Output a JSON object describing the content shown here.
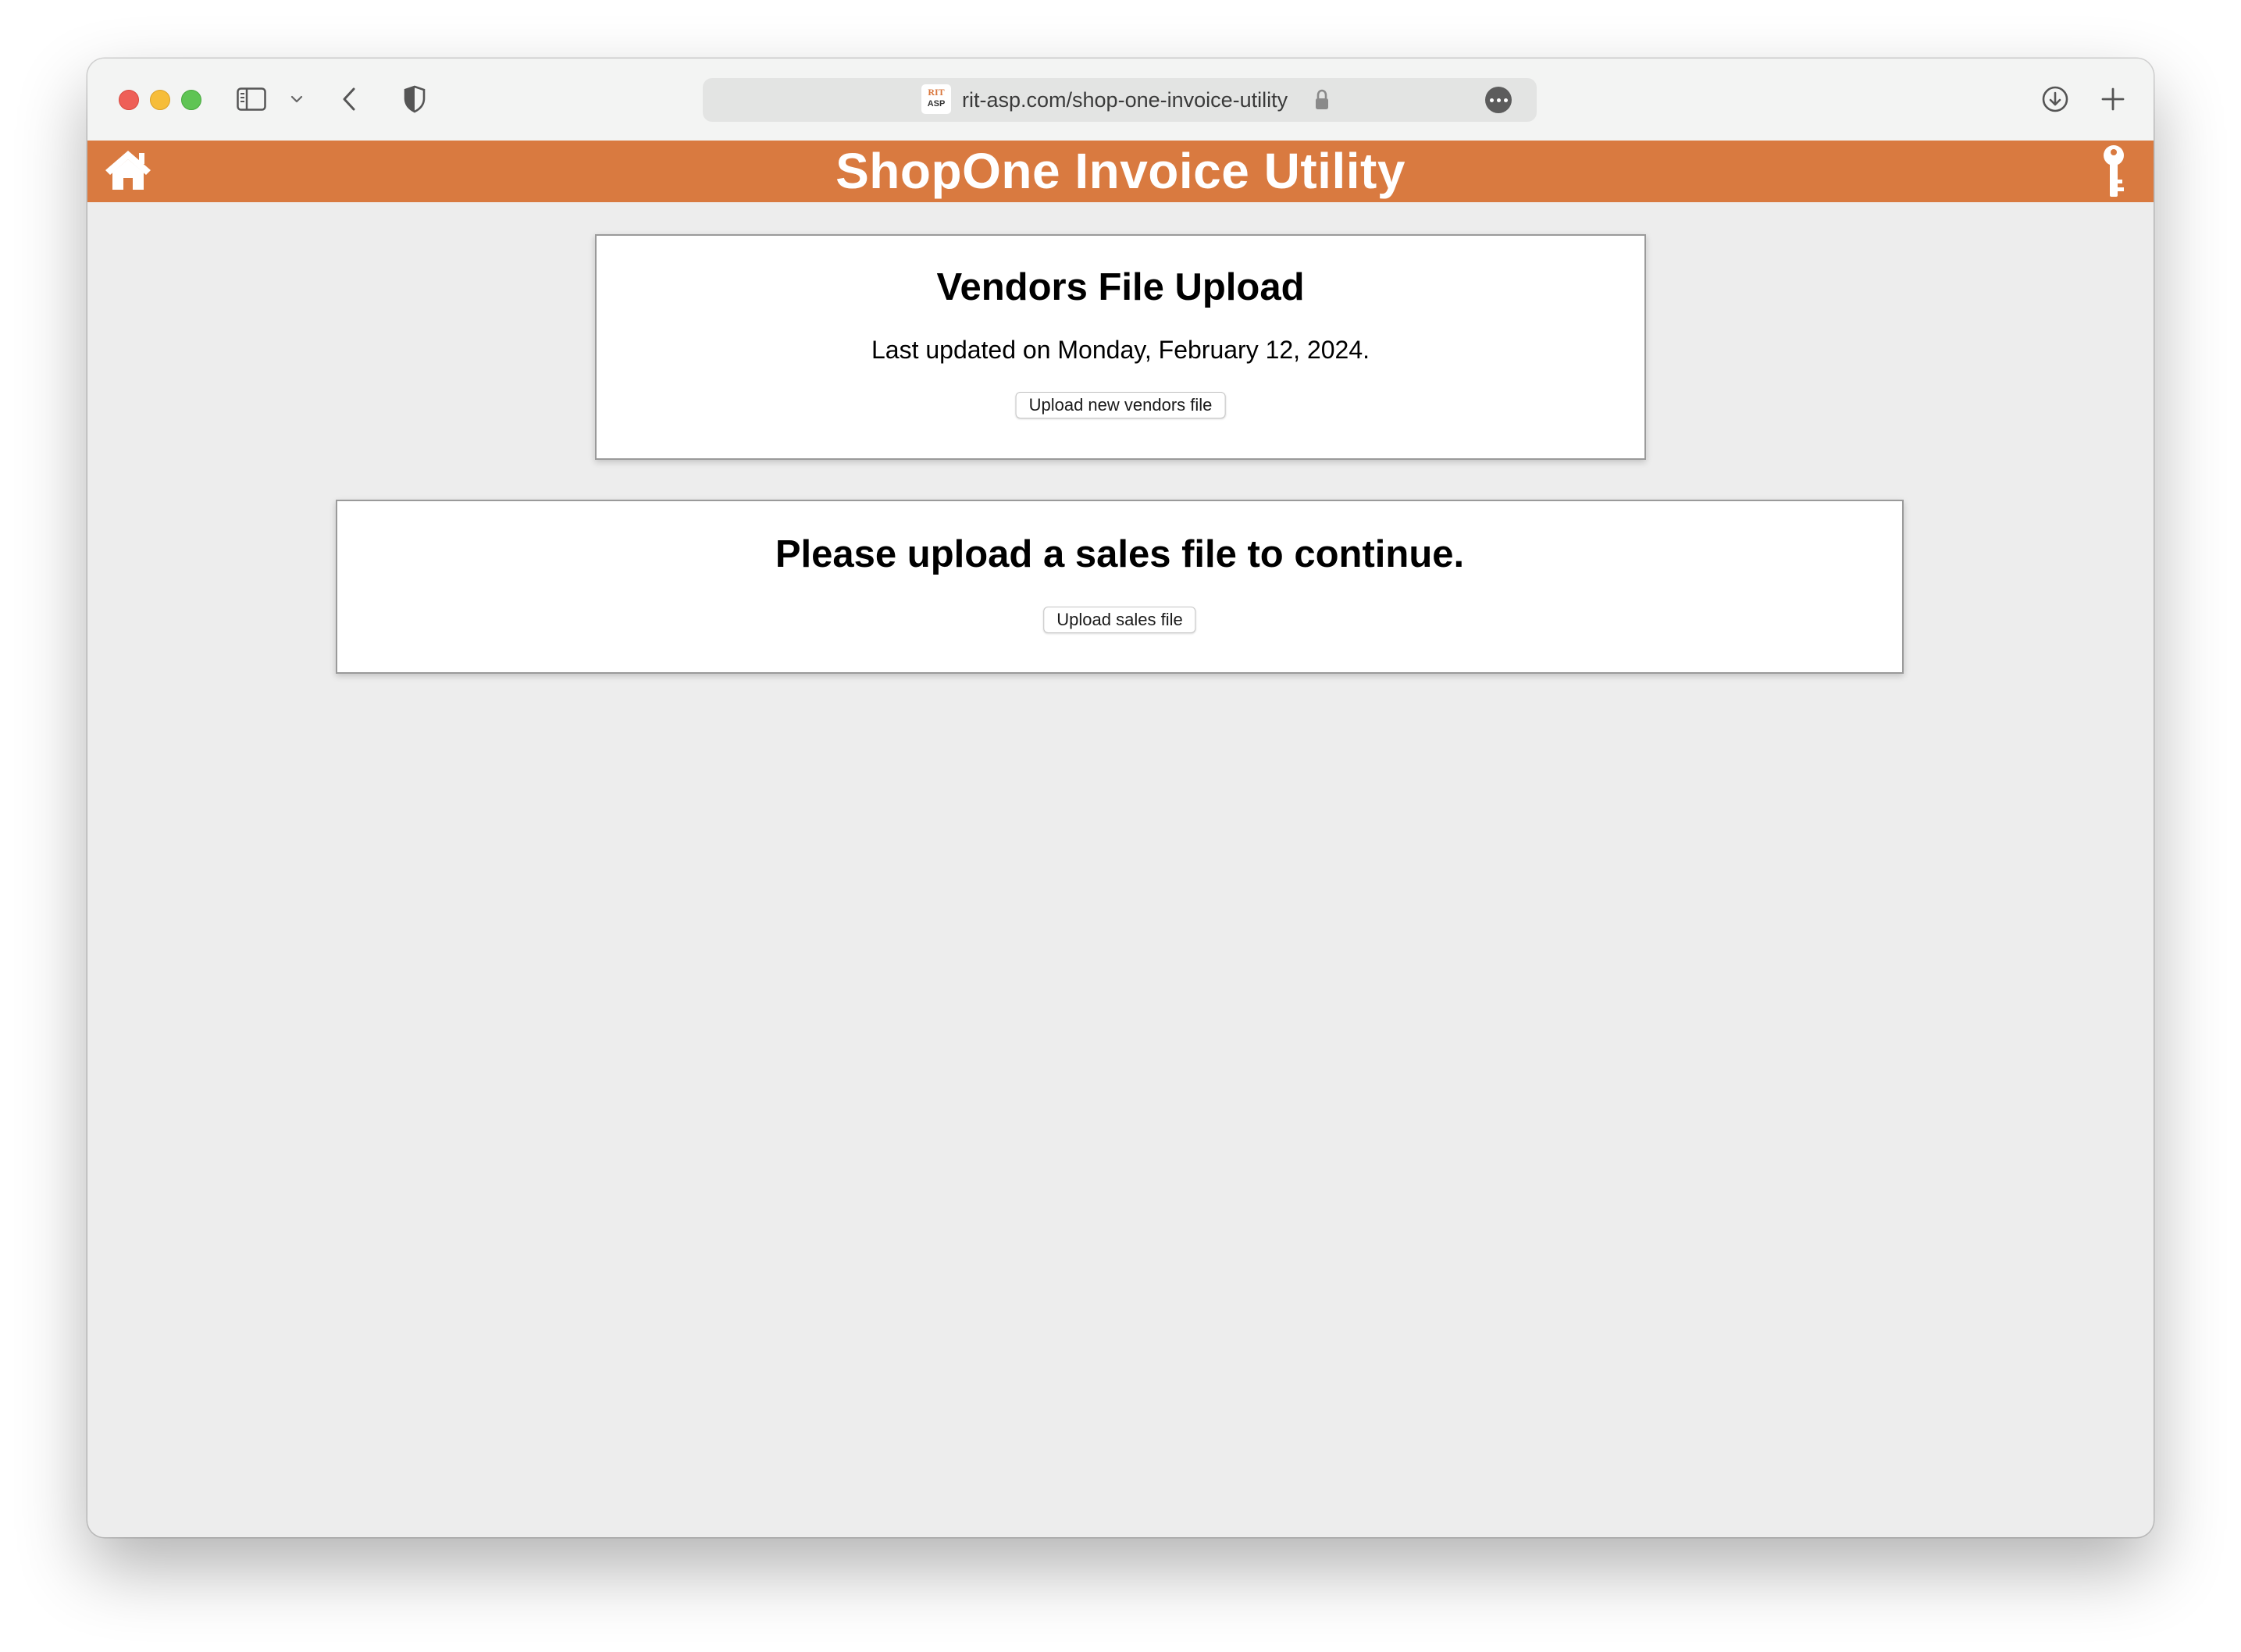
{
  "browser": {
    "url": "rit-asp.com/shop-one-invoice-utility",
    "favicon_top": "RIT",
    "favicon_bottom": "ASP",
    "icons": [
      "sidebar-icon",
      "chevron-down-icon",
      "back-arrow-icon",
      "shield-icon",
      "lock-icon",
      "more-icon",
      "download-icon",
      "plus-icon"
    ]
  },
  "header": {
    "title": "ShopOne Invoice Utility",
    "background_color": "#d97a40",
    "left_icon": "home-icon",
    "right_icon": "key-icon"
  },
  "vendors_card": {
    "title": "Vendors File Upload",
    "last_updated": "Last updated on Monday, February 12, 2024.",
    "button_label": "Upload new vendors file"
  },
  "sales_card": {
    "title": "Please upload a sales file to continue.",
    "button_label": "Upload sales file"
  }
}
